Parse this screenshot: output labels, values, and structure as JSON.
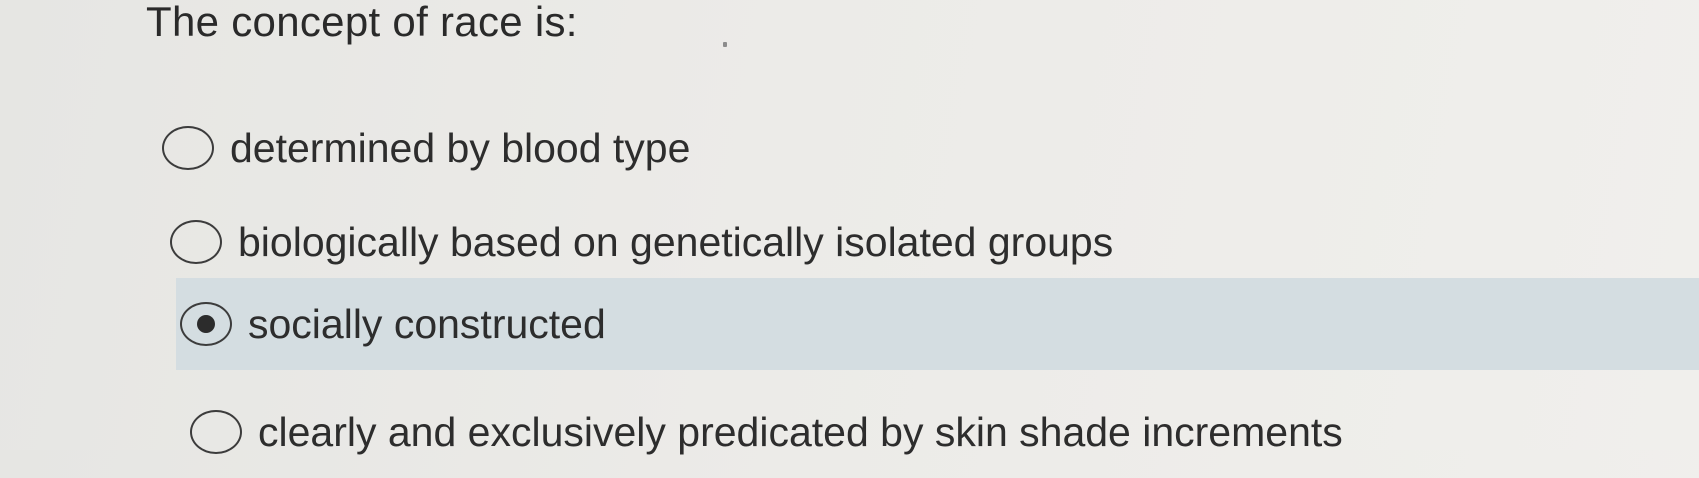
{
  "question": {
    "title": "The concept of race is:"
  },
  "options": [
    {
      "label": "determined by blood type",
      "selected": false
    },
    {
      "label": "biologically based on genetically isolated groups",
      "selected": false
    },
    {
      "label": "socially constructed",
      "selected": true
    },
    {
      "label": "clearly and exclusively predicated by skin shade increments",
      "selected": false
    }
  ],
  "colors": {
    "selected_row_background": "#d4dde1",
    "text": "#2d2d2d"
  }
}
